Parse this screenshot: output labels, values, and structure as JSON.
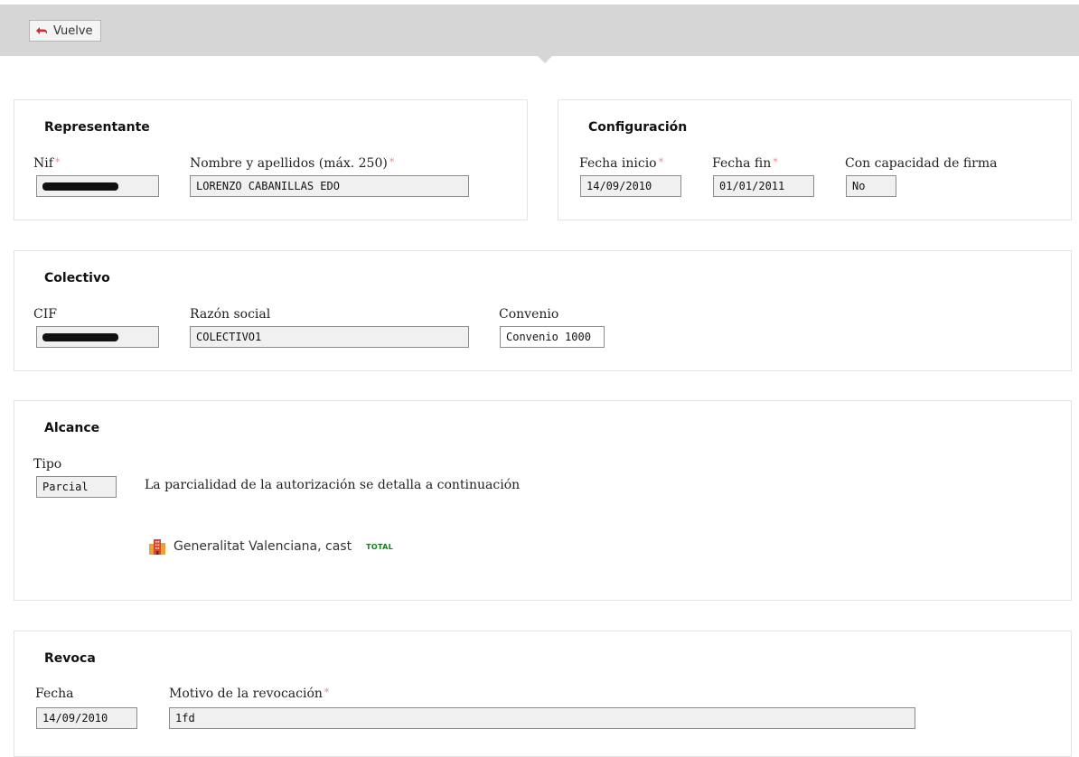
{
  "toolbar": {
    "back_label": "Vuelve"
  },
  "representante": {
    "title": "Representante",
    "nif_label": "Nif",
    "nombre_label": "Nombre y apellidos (máx. 250)",
    "nombre_value": "LORENZO CABANILLAS EDO",
    "required_mark": "*"
  },
  "configuracion": {
    "title": "Configuración",
    "fecha_inicio_label": "Fecha inicio",
    "fecha_inicio_value": "14/09/2010",
    "fecha_fin_label": "Fecha fin",
    "fecha_fin_value": "01/01/2011",
    "firma_label": "Con capacidad de firma",
    "firma_value": "No",
    "required_mark": "*"
  },
  "colectivo": {
    "title": "Colectivo",
    "cif_label": "CIF",
    "razon_label": "Razón social",
    "razon_value": "COLECTIVO1",
    "convenio_label": "Convenio",
    "convenio_value": "Convenio 1000"
  },
  "alcance": {
    "title": "Alcance",
    "tipo_label": "Tipo",
    "tipo_value": "Parcial",
    "description": "La parcialidad de la autorización se detalla a continuación",
    "entity_name": "Generalitat Valenciana, cast",
    "entity_badge": "TOTAL",
    "entity_icon": "building-icon"
  },
  "revoca": {
    "title": "Revoca",
    "fecha_label": "Fecha",
    "fecha_value": "14/09/2010",
    "motivo_label": "Motivo de la revocación",
    "motivo_value": "1fd",
    "required_mark": "*"
  },
  "colors": {
    "required": "#f08a8a",
    "badge": "#1a7a1a",
    "topbar": "#d6d6d6"
  }
}
